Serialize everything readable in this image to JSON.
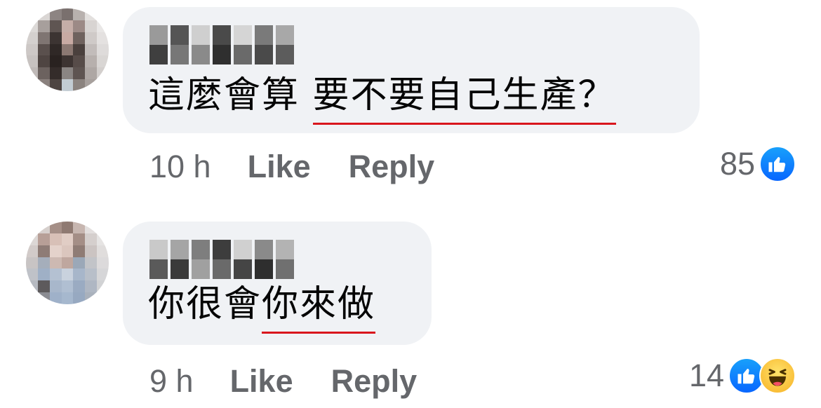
{
  "comments": [
    {
      "text_plain": "這麼會算 ",
      "text_underlined": "要不要自己生產？",
      "timestamp": "10 h",
      "like_label": "Like",
      "reply_label": "Reply",
      "reaction_count": "85",
      "reactions": [
        "like-icon"
      ]
    },
    {
      "text_plain": "你很會",
      "text_underlined": "你來做",
      "timestamp": "9 h",
      "like_label": "Like",
      "reply_label": "Reply",
      "reaction_count": "14",
      "reactions": [
        "like-icon",
        "haha-icon"
      ]
    }
  ],
  "colors": {
    "bubble": "#f0f2f5",
    "action_text": "#65676b",
    "underline": "#d9161d",
    "like_blue": "#0866ff",
    "haha_yellow": "#f7b125"
  }
}
